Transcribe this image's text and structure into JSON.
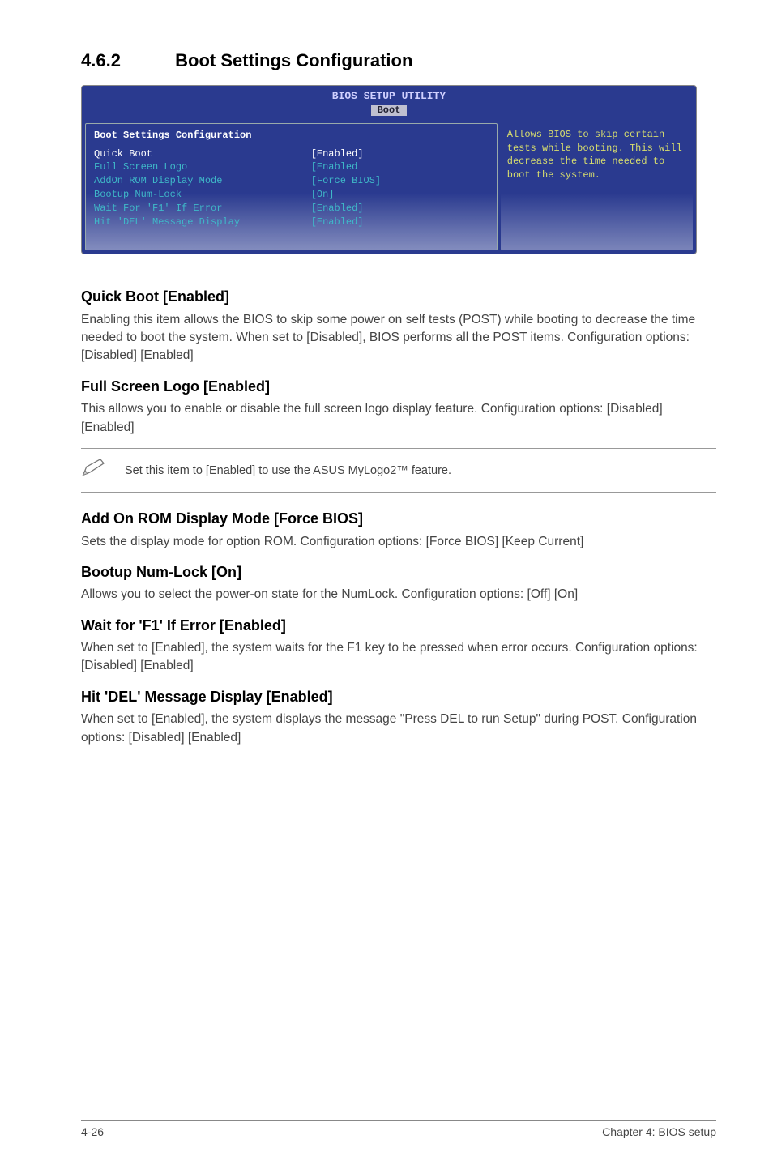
{
  "section": {
    "number": "4.6.2",
    "title": "Boot Settings Configuration"
  },
  "bios": {
    "utility_title": "BIOS SETUP UTILITY",
    "tab": "Boot",
    "panel_heading": "Boot Settings Configuration",
    "rows": [
      {
        "label": "Quick Boot",
        "value": "[Enabled]",
        "highlight": true
      },
      {
        "label": "Full Screen Logo",
        "value": "[Enabled"
      },
      {
        "label": "AddOn ROM Display Mode",
        "value": "[Force BIOS]"
      },
      {
        "label": "Bootup Num-Lock",
        "value": "[On]"
      },
      {
        "label": "Wait For 'F1' If Error",
        "value": "[Enabled]"
      },
      {
        "label": "Hit 'DEL' Message Display",
        "value": "[Enabled]"
      }
    ],
    "help_text": "Allows BIOS to skip certain tests while booting. This will decrease the time needed to boot the system."
  },
  "items": {
    "quick_boot": {
      "heading": "Quick Boot [Enabled]",
      "body": "Enabling this item allows the BIOS to skip some power on self tests (POST) while booting to decrease the time needed to boot the system. When set to [Disabled], BIOS performs all the POST items. Configuration options: [Disabled] [Enabled]"
    },
    "full_screen_logo": {
      "heading": "Full Screen Logo [Enabled]",
      "body": "This allows you to enable or disable the full screen logo display feature. Configuration options: [Disabled] [Enabled]"
    },
    "note": "Set this item to [Enabled] to use the ASUS MyLogo2™ feature.",
    "addon_rom": {
      "heading": "Add On ROM Display Mode [Force BIOS]",
      "body": "Sets the display mode for option ROM. Configuration options: [Force BIOS] [Keep Current]"
    },
    "numlock": {
      "heading": "Bootup Num-Lock [On]",
      "body": "Allows you to select the power-on state for the NumLock. Configuration options: [Off] [On]"
    },
    "wait_f1": {
      "heading": "Wait for 'F1' If Error [Enabled]",
      "body": "When set to [Enabled], the system waits for the F1 key to be pressed when error occurs. Configuration options: [Disabled] [Enabled]"
    },
    "hit_del": {
      "heading": "Hit 'DEL' Message Display [Enabled]",
      "body": "When set to [Enabled], the system displays the message \"Press DEL to run Setup\" during POST. Configuration options: [Disabled] [Enabled]"
    }
  },
  "footer": {
    "page": "4-26",
    "chapter": "Chapter 4: BIOS setup"
  }
}
